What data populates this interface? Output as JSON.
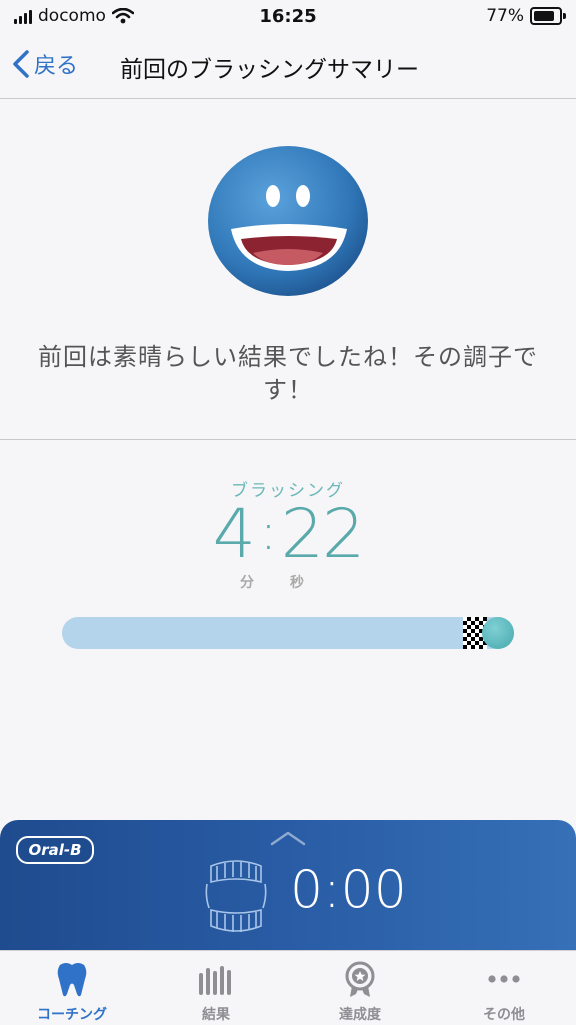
{
  "status_bar": {
    "carrier": "docomo",
    "time": "16:25",
    "battery": "77%"
  },
  "nav": {
    "back_label": "戻る",
    "title": "前回のブラッシングサマリー"
  },
  "result": {
    "message": "前回は素晴らしい結果でしたね！その調子です！"
  },
  "brushing": {
    "label": "ブラッシング",
    "minutes": "4",
    "seconds": "22",
    "unit_minutes": "分",
    "unit_seconds": "秒",
    "progress": 1.0
  },
  "panel": {
    "logo": "Oral-B",
    "timer": "0:00"
  },
  "tabs": [
    {
      "label": "コーチング",
      "icon": "tooth-icon",
      "active": true
    },
    {
      "label": "結果",
      "icon": "bar-chart-icon",
      "active": false
    },
    {
      "label": "達成度",
      "icon": "medal-icon",
      "active": false
    },
    {
      "label": "その他",
      "icon": "more-icon",
      "active": false
    }
  ],
  "colors": {
    "accent": "#2f72c8",
    "teal": "#5aa9ab",
    "panel": "#2a5ea7"
  }
}
